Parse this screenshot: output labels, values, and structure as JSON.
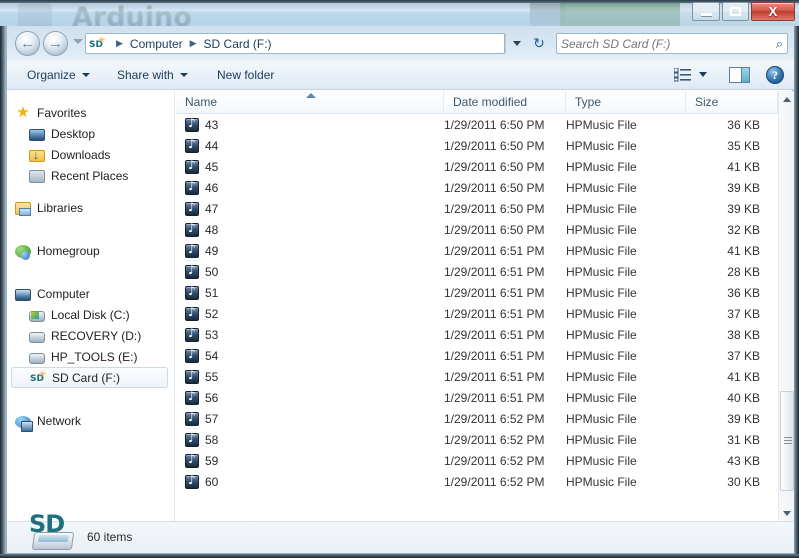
{
  "window": {
    "background_app_title": "Arduino",
    "controls": {
      "minimize": "–",
      "maximize": "□",
      "close": "X"
    }
  },
  "address_bar": {
    "back_label": "←",
    "forward_label": "→",
    "drive_icon": "sd-card-icon",
    "breadcrumbs": [
      "Computer",
      "SD Card (F:)"
    ],
    "separator": "▶",
    "dropdown_icon": "chevron-down-icon",
    "refresh_icon": "refresh-icon",
    "refresh_glyph": "↻"
  },
  "search": {
    "placeholder": "Search SD Card (F:)",
    "value": "",
    "icon": "search-icon",
    "icon_glyph": "⌕"
  },
  "toolbar": {
    "organize_label": "Organize",
    "share_with_label": "Share with",
    "new_folder_label": "New folder",
    "view_icon": "view-list-icon",
    "preview_pane_icon": "preview-pane-icon",
    "help_icon": "help-icon",
    "help_glyph": "?"
  },
  "sidebar": {
    "groups": [
      {
        "header": {
          "label": "Favorites",
          "icon": "star-icon"
        },
        "items": [
          {
            "label": "Desktop",
            "icon": "desktop-icon"
          },
          {
            "label": "Downloads",
            "icon": "downloads-folder-icon"
          },
          {
            "label": "Recent Places",
            "icon": "recent-places-icon"
          }
        ]
      },
      {
        "header": {
          "label": "Libraries",
          "icon": "libraries-icon"
        },
        "items": []
      },
      {
        "header": {
          "label": "Homegroup",
          "icon": "homegroup-icon"
        },
        "items": []
      },
      {
        "header": {
          "label": "Computer",
          "icon": "computer-icon"
        },
        "items": [
          {
            "label": "Local Disk (C:)",
            "icon": "local-disk-icon",
            "selected": false
          },
          {
            "label": "RECOVERY (D:)",
            "icon": "drive-icon",
            "selected": false
          },
          {
            "label": "HP_TOOLS (E:)",
            "icon": "drive-icon",
            "selected": false
          },
          {
            "label": "SD Card (F:)",
            "icon": "sd-card-icon",
            "selected": true
          }
        ]
      },
      {
        "header": {
          "label": "Network",
          "icon": "network-icon"
        },
        "items": []
      }
    ]
  },
  "file_list": {
    "columns": [
      {
        "key": "name",
        "label": "Name",
        "sorted": "asc"
      },
      {
        "key": "date",
        "label": "Date modified"
      },
      {
        "key": "type",
        "label": "Type"
      },
      {
        "key": "size",
        "label": "Size"
      }
    ],
    "rows": [
      {
        "name": "43",
        "date": "1/29/2011 6:50 PM",
        "type": "HPMusic File",
        "size": "36 KB"
      },
      {
        "name": "44",
        "date": "1/29/2011 6:50 PM",
        "type": "HPMusic File",
        "size": "35 KB"
      },
      {
        "name": "45",
        "date": "1/29/2011 6:50 PM",
        "type": "HPMusic File",
        "size": "41 KB"
      },
      {
        "name": "46",
        "date": "1/29/2011 6:50 PM",
        "type": "HPMusic File",
        "size": "39 KB"
      },
      {
        "name": "47",
        "date": "1/29/2011 6:50 PM",
        "type": "HPMusic File",
        "size": "39 KB"
      },
      {
        "name": "48",
        "date": "1/29/2011 6:50 PM",
        "type": "HPMusic File",
        "size": "32 KB"
      },
      {
        "name": "49",
        "date": "1/29/2011 6:51 PM",
        "type": "HPMusic File",
        "size": "41 KB"
      },
      {
        "name": "50",
        "date": "1/29/2011 6:51 PM",
        "type": "HPMusic File",
        "size": "28 KB"
      },
      {
        "name": "51",
        "date": "1/29/2011 6:51 PM",
        "type": "HPMusic File",
        "size": "36 KB"
      },
      {
        "name": "52",
        "date": "1/29/2011 6:51 PM",
        "type": "HPMusic File",
        "size": "37 KB"
      },
      {
        "name": "53",
        "date": "1/29/2011 6:51 PM",
        "type": "HPMusic File",
        "size": "38 KB"
      },
      {
        "name": "54",
        "date": "1/29/2011 6:51 PM",
        "type": "HPMusic File",
        "size": "37 KB"
      },
      {
        "name": "55",
        "date": "1/29/2011 6:51 PM",
        "type": "HPMusic File",
        "size": "41 KB"
      },
      {
        "name": "56",
        "date": "1/29/2011 6:51 PM",
        "type": "HPMusic File",
        "size": "40 KB"
      },
      {
        "name": "57",
        "date": "1/29/2011 6:52 PM",
        "type": "HPMusic File",
        "size": "39 KB"
      },
      {
        "name": "58",
        "date": "1/29/2011 6:52 PM",
        "type": "HPMusic File",
        "size": "31 KB"
      },
      {
        "name": "59",
        "date": "1/29/2011 6:52 PM",
        "type": "HPMusic File",
        "size": "43 KB"
      },
      {
        "name": "60",
        "date": "1/29/2011 6:52 PM",
        "type": "HPMusic File",
        "size": "30 KB"
      }
    ],
    "row_icon": "music-file-icon"
  },
  "status_bar": {
    "drive_icon": "sd-card-large-icon",
    "drive_label": "SD",
    "item_count_text": "60 items"
  },
  "colors": {
    "accent_blue": "#1a3c5e",
    "close_red": "#bf3d2d",
    "sd_teal": "#1e6f80",
    "link_blue": "#2a6099"
  }
}
